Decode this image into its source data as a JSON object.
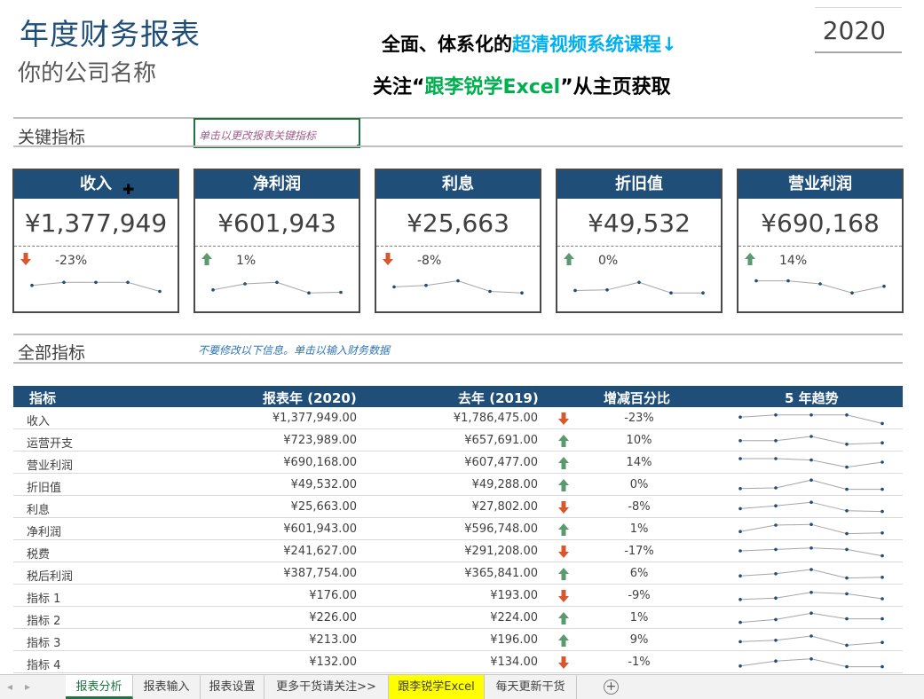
{
  "header": {
    "title": "年度财务报表",
    "subtitle": "你的公司名称",
    "year": "2020",
    "promo_line1_pre": "全面、体系化的",
    "promo_line1_hl": "超清视频系统课程",
    "promo_line1_post": "↓",
    "promo_line2_pre": "关注“",
    "promo_line2_hl": "跟李锐学Excel",
    "promo_line2_post": "”从主页获取"
  },
  "key_section": {
    "label": "关键指标",
    "edit_hint": "单击以更改报表关键指标"
  },
  "cards": [
    {
      "title": "收入",
      "value": "¥1,377,949",
      "change": "-23%",
      "dir": "down",
      "trend": [
        0.55,
        0.45,
        0.45,
        0.45,
        0.75
      ]
    },
    {
      "title": "净利润",
      "value": "¥601,943",
      "change": "1%",
      "dir": "up",
      "trend": [
        0.7,
        0.5,
        0.45,
        0.8,
        0.78
      ]
    },
    {
      "title": "利息",
      "value": "¥25,663",
      "change": "-8%",
      "dir": "down",
      "trend": [
        0.6,
        0.55,
        0.4,
        0.75,
        0.8
      ]
    },
    {
      "title": "折旧值",
      "value": "¥49,532",
      "change": "0%",
      "dir": "up",
      "trend": [
        0.72,
        0.7,
        0.45,
        0.8,
        0.8
      ]
    },
    {
      "title": "营业利润",
      "value": "¥690,168",
      "change": "14%",
      "dir": "up",
      "trend": [
        0.4,
        0.4,
        0.5,
        0.8,
        0.58
      ]
    }
  ],
  "all_section": {
    "label": "全部指标",
    "hint": "不要修改以下信息。单击以输入财务数据"
  },
  "table": {
    "headers": [
      "指标",
      "报表年 (2020)",
      "去年 (2019)",
      "增减百分比",
      "5 年趋势"
    ],
    "rows": [
      {
        "name": "收入",
        "cur": "¥1,377,949.00",
        "prev": "¥1,786,475.00",
        "pct": "-23%",
        "dir": "down",
        "trend": [
          0.45,
          0.3,
          0.3,
          0.3,
          0.9
        ]
      },
      {
        "name": "运营开支",
        "cur": "¥723,989.00",
        "prev": "¥657,691.00",
        "pct": "10%",
        "dir": "up",
        "trend": [
          0.55,
          0.55,
          0.25,
          0.8,
          0.7
        ]
      },
      {
        "name": "营业利润",
        "cur": "¥690,168.00",
        "prev": "¥607,477.00",
        "pct": "14%",
        "dir": "up",
        "trend": [
          0.25,
          0.25,
          0.35,
          0.85,
          0.5
        ]
      },
      {
        "name": "折旧值",
        "cur": "¥49,532.00",
        "prev": "¥49,288.00",
        "pct": "0%",
        "dir": "up",
        "trend": [
          0.8,
          0.75,
          0.2,
          0.85,
          0.85
        ]
      },
      {
        "name": "利息",
        "cur": "¥25,663.00",
        "prev": "¥27,802.00",
        "pct": "-8%",
        "dir": "down",
        "trend": [
          0.65,
          0.45,
          0.2,
          0.8,
          0.85
        ]
      },
      {
        "name": "净利润",
        "cur": "¥601,943.00",
        "prev": "¥596,748.00",
        "pct": "1%",
        "dir": "up",
        "trend": [
          0.7,
          0.25,
          0.2,
          0.85,
          0.8
        ]
      },
      {
        "name": "税费",
        "cur": "¥241,627.00",
        "prev": "¥291,208.00",
        "pct": "-17%",
        "dir": "down",
        "trend": [
          0.5,
          0.4,
          0.3,
          0.4,
          0.85
        ]
      },
      {
        "name": "税后利润",
        "cur": "¥387,754.00",
        "prev": "¥365,841.00",
        "pct": "6%",
        "dir": "up",
        "trend": [
          0.7,
          0.55,
          0.25,
          0.85,
          0.8
        ]
      },
      {
        "name": "指标 1",
        "cur": "¥176.00",
        "prev": "¥193.00",
        "pct": "-9%",
        "dir": "down",
        "trend": [
          0.8,
          0.7,
          0.3,
          0.4,
          0.75
        ]
      },
      {
        "name": "指标 2",
        "cur": "¥226.00",
        "prev": "¥224.00",
        "pct": "1%",
        "dir": "up",
        "trend": [
          0.85,
          0.65,
          0.2,
          0.6,
          0.6
        ]
      },
      {
        "name": "指标 3",
        "cur": "¥213.00",
        "prev": "¥196.00",
        "pct": "9%",
        "dir": "up",
        "trend": [
          0.65,
          0.55,
          0.25,
          0.9,
          0.7
        ]
      },
      {
        "name": "指标 4",
        "cur": "¥132.00",
        "prev": "¥134.00",
        "pct": "-1%",
        "dir": "down",
        "trend": [
          0.8,
          0.45,
          0.3,
          0.85,
          0.85
        ]
      }
    ]
  },
  "sheet_tabs": [
    {
      "label": "报表分析",
      "active": true,
      "yellow": false
    },
    {
      "label": "报表输入",
      "active": false,
      "yellow": false
    },
    {
      "label": "报表设置",
      "active": false,
      "yellow": false
    },
    {
      "label": "更多干货请关注>>",
      "active": false,
      "yellow": false
    },
    {
      "label": "跟李锐学Excel",
      "active": false,
      "yellow": true
    },
    {
      "label": "每天更新干货",
      "active": false,
      "yellow": false
    }
  ],
  "colors": {
    "header_blue": "#1f4e79",
    "up_green": "#5b9a6e",
    "down_red": "#d9572c",
    "spark_line": "#a6a6a6",
    "spark_dot": "#1f4e79"
  }
}
